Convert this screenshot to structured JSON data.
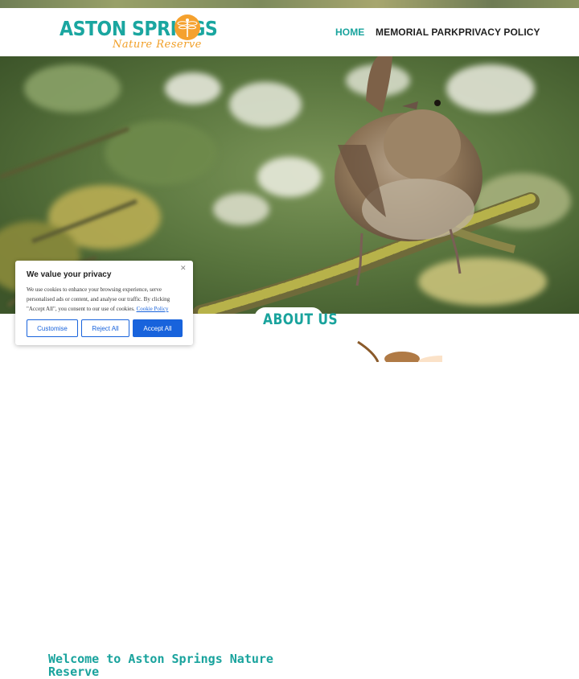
{
  "brand": {
    "title": "ASTON SPRINGS",
    "subtitle": "Nature Reserve",
    "accent_color": "#19a39d",
    "secondary_color": "#f5a12e",
    "badge_icon": "dragonfly-icon"
  },
  "nav": {
    "home": "HOME",
    "memorial": "MEMORIAL PARK",
    "privacy": "PRIVACY POLICY"
  },
  "hero": {
    "image": "wren-bird-on-lichen-branch"
  },
  "about": {
    "heading": "ABOUT US",
    "welcome": "Welcome to Aston Springs Nature Reserve"
  },
  "cookie": {
    "title": "We value your privacy",
    "body": "We use cookies to enhance your browsing experience, serve personalised ads or content, and analyse our traffic. By clicking \"Accept All\", you consent to our use of cookies. ",
    "link": "Cookie Policy",
    "close_icon": "close-icon",
    "customise": "Customise",
    "reject": "Reject All",
    "accept": "Accept All",
    "button_color": "#1863dc"
  }
}
